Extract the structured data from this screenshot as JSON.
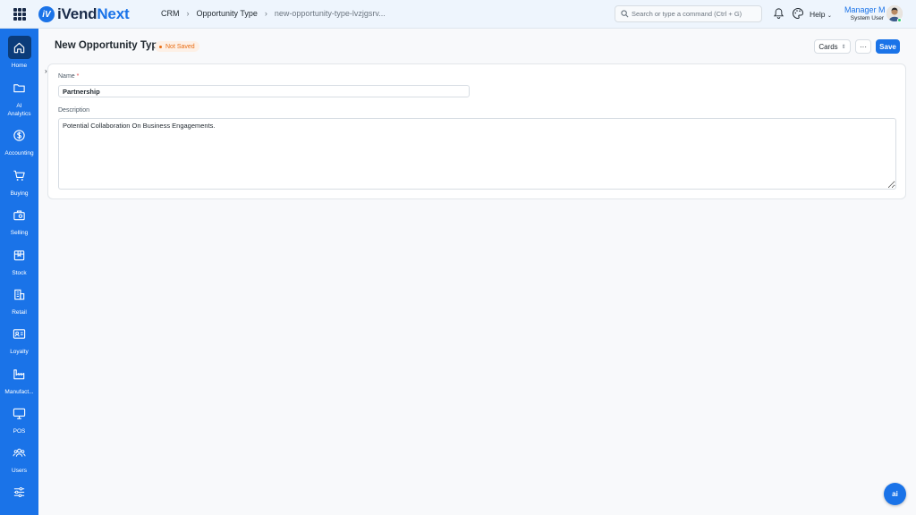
{
  "app": {
    "logo_mark": "iV",
    "logo_prefix": "iVend",
    "logo_suffix": "Next"
  },
  "breadcrumb": [
    "CRM",
    "Opportunity Type",
    "new-opportunity-type-lvzjgsrv..."
  ],
  "search": {
    "placeholder": "Search or type a command (Ctrl + G)"
  },
  "help_label": "Help",
  "user": {
    "name": "Manager M",
    "role": "System User"
  },
  "sidebar": {
    "items": [
      {
        "label": "Home",
        "icon": "home-icon",
        "active": true
      },
      {
        "label": "AI Analytics",
        "icon": "folder-icon"
      },
      {
        "label": "Accounting",
        "icon": "dollar-icon"
      },
      {
        "label": "Buying",
        "icon": "cart-icon"
      },
      {
        "label": "Selling",
        "icon": "briefcase-icon"
      },
      {
        "label": "Stock",
        "icon": "box-icon"
      },
      {
        "label": "Retail",
        "icon": "store-icon"
      },
      {
        "label": "Loyalty",
        "icon": "id-card-icon"
      },
      {
        "label": "Manufact...",
        "icon": "factory-icon"
      },
      {
        "label": "POS",
        "icon": "monitor-icon"
      },
      {
        "label": "Users",
        "icon": "users-icon"
      },
      {
        "label": "",
        "icon": "sliders-icon"
      }
    ]
  },
  "page": {
    "title": "New Opportunity Type",
    "status": "Not Saved"
  },
  "actions": {
    "view_label": "Cards",
    "more_label": "···",
    "save_label": "Save"
  },
  "form": {
    "name_label": "Name",
    "name_required": "*",
    "name_value": "Partnership",
    "description_label": "Description",
    "description_value": "Potential Collaboration On Business Engagements."
  },
  "chat_label": "ai",
  "colors": {
    "accent": "#1a73e8",
    "sidebar_active": "#0b3c7a",
    "status": "#e86c13"
  }
}
